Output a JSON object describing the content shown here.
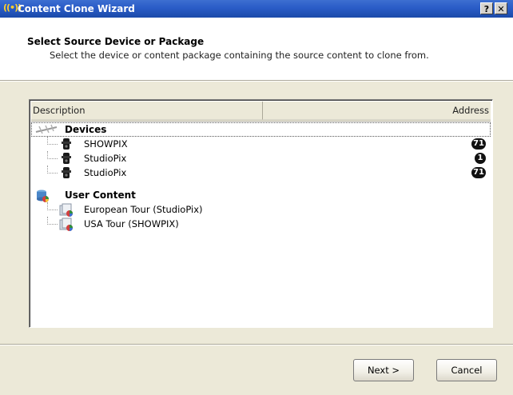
{
  "window": {
    "title": "Content Clone Wizard",
    "help_label": "?",
    "close_label": "✕"
  },
  "header": {
    "heading": "Select Source Device or Package",
    "subtitle": "Select the device or content package containing the source content to clone from."
  },
  "list": {
    "columns": [
      "Description",
      "Address"
    ],
    "groups": [
      {
        "label": "Devices",
        "icon": "network-devices-icon",
        "items": [
          {
            "label": "SHOWPIX",
            "address": "71",
            "icon": "device-icon"
          },
          {
            "label": "StudioPix",
            "address": "1",
            "icon": "device-icon"
          },
          {
            "label": "StudioPix",
            "address": "71",
            "icon": "device-icon"
          }
        ]
      },
      {
        "label": "User Content",
        "icon": "user-content-database-icon",
        "items": [
          {
            "label": "European Tour (StudioPix)",
            "icon": "content-package-icon"
          },
          {
            "label": "USA Tour (SHOWPIX)",
            "icon": "content-package-icon"
          }
        ]
      }
    ]
  },
  "buttons": {
    "next": "Next >",
    "cancel": "Cancel"
  },
  "colors": {
    "titlebar": "#2a5cc7",
    "dialog_bg": "#ece9d8",
    "badge": "#111111"
  }
}
